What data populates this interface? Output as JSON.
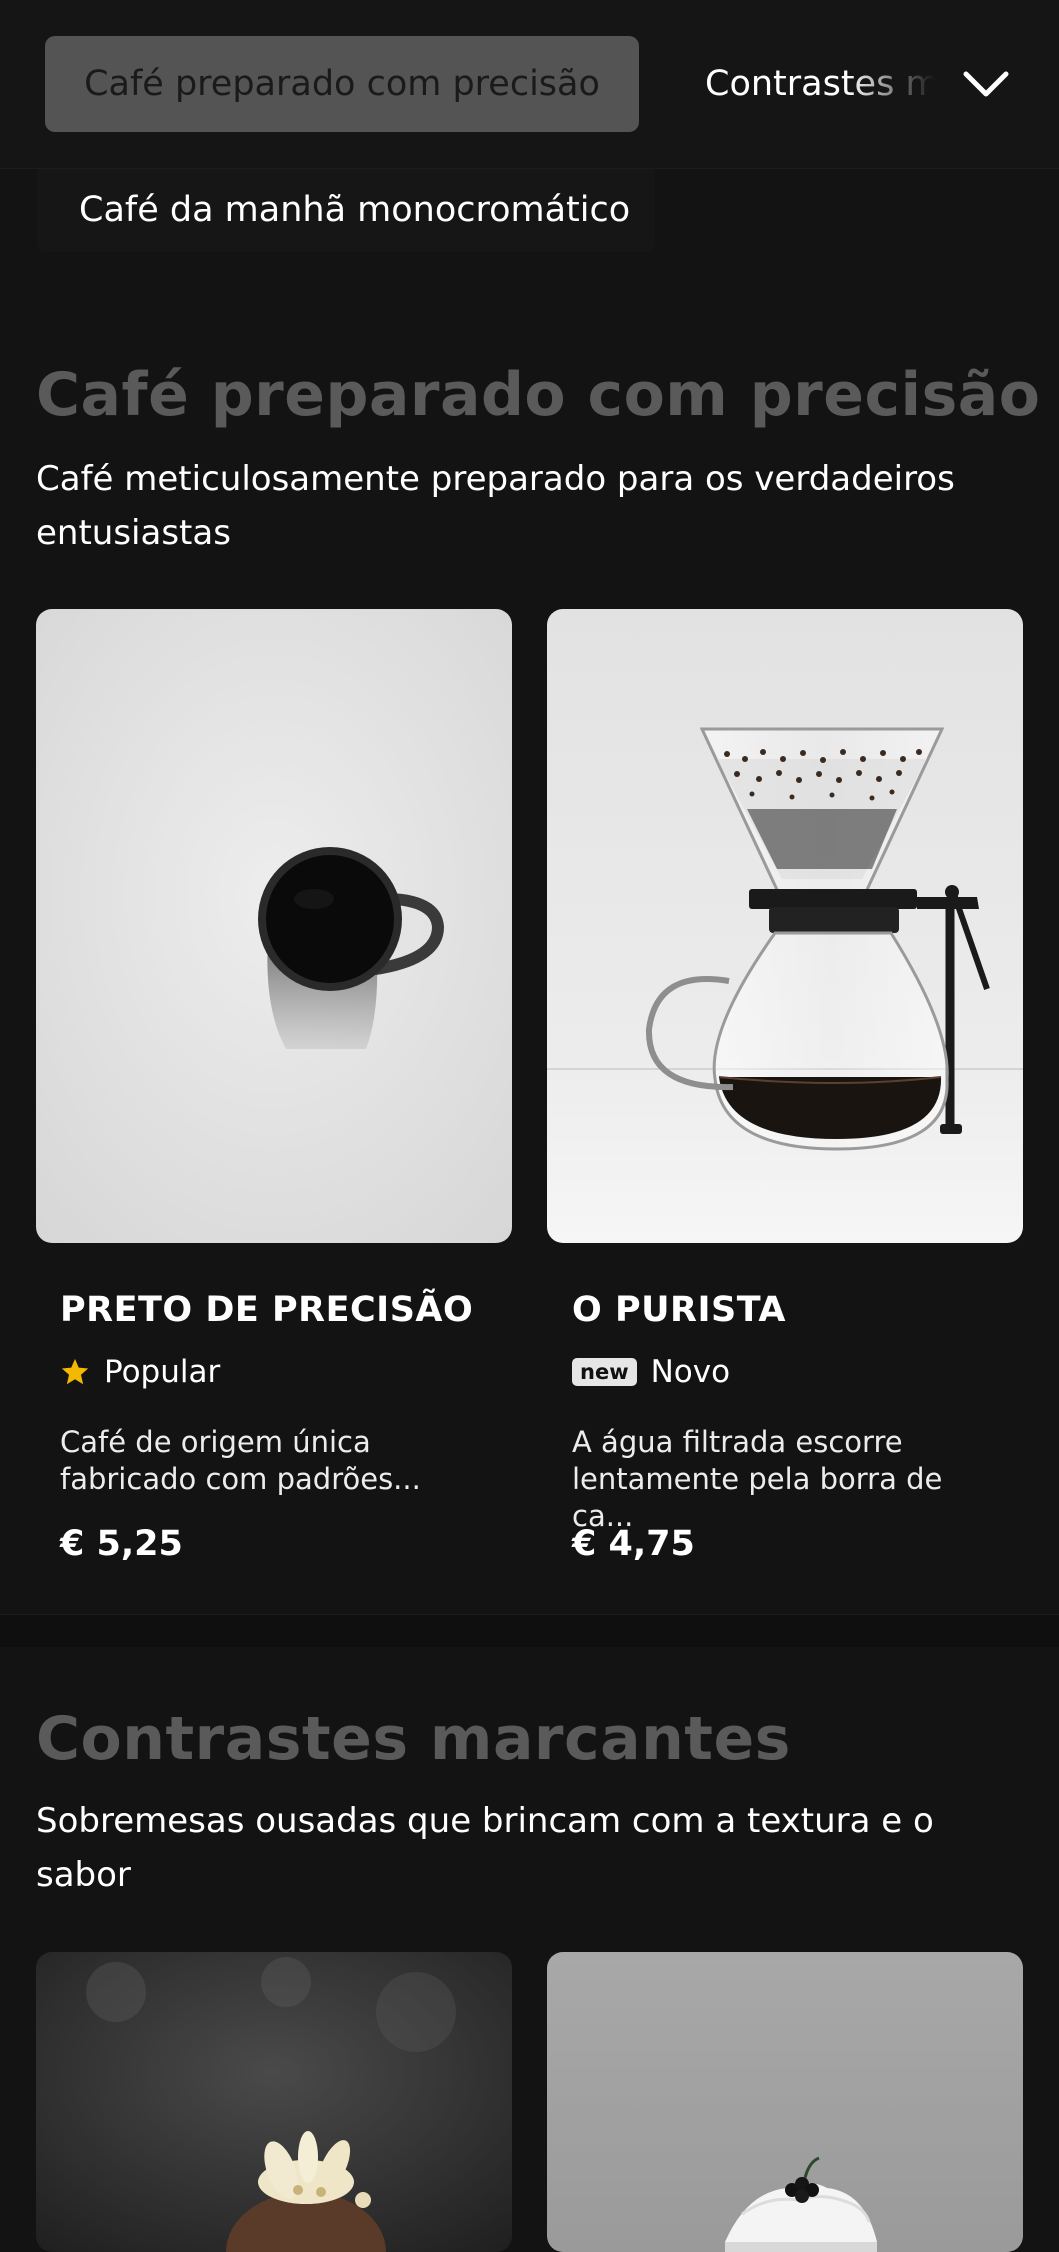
{
  "categories": {
    "active": "Café preparado com precisão",
    "next": "Contrastes marcantes",
    "third": "Café da manhã monocromático"
  },
  "sections": [
    {
      "title": "Café preparado com precisão",
      "subtitle": "Café meticulosamente preparado para os verdadeiros entusiastas",
      "products": [
        {
          "name": "PRETO DE PRECISÃO",
          "badge_icon": "star-icon",
          "badge": "Popular",
          "description_l1": "Café de origem única",
          "description_l2": "fabricado com padrões...",
          "price": "€ 5,25"
        },
        {
          "name": "O PURISTA",
          "badge_icon": "new-tag-icon",
          "badge_tag": "new",
          "badge": "Novo",
          "description_l1": "A água filtrada escorre",
          "description_l2": "lentamente pela borra de ca...",
          "price": "€ 4,75"
        }
      ]
    },
    {
      "title": "Contrastes marcantes",
      "subtitle": "Sobremesas ousadas que brincam com a textura e o sabor"
    }
  ],
  "colors": {
    "background": "#131313",
    "accent_star": "#f5b800",
    "muted_title": "#5a5a5a"
  }
}
